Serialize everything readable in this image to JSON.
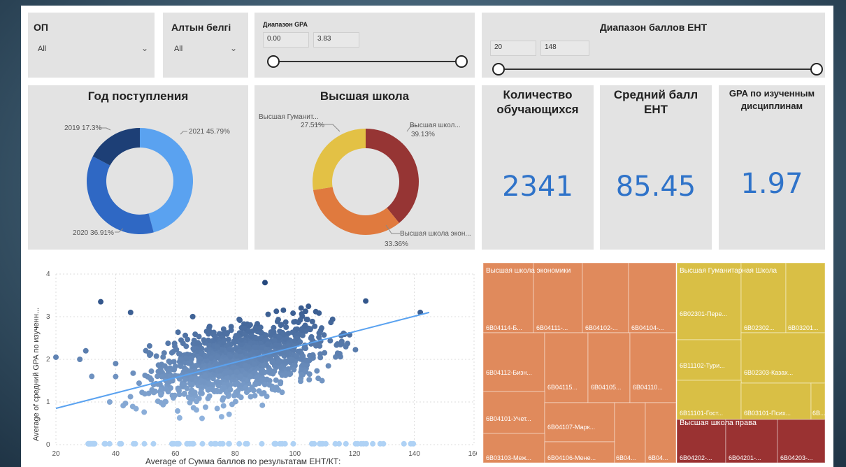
{
  "slicers": {
    "op": {
      "title": "ОП",
      "value": "All"
    },
    "gold": {
      "title": "Алтын белгі",
      "value": "All"
    },
    "gpa": {
      "title": "Диапазон GPA",
      "min": "0.00",
      "max": "3.83"
    },
    "ent": {
      "title": "Диапазон баллов ЕНТ",
      "min": "20",
      "max": "148"
    }
  },
  "kpis": {
    "count": {
      "title_line1": "Количество",
      "title_line2": "обучающихся",
      "value": "2341"
    },
    "ent_avg": {
      "title_line1": "Средний балл",
      "title_line2": "ЕНТ",
      "value": "85.45"
    },
    "gpa_avg": {
      "title_line1": "GPA по изученным",
      "title_line2": "дисциплинам",
      "value": "1.97"
    }
  },
  "colors": {
    "accent": "#2f73c9",
    "donut1": [
      "#5aa2f0",
      "#2f68c4",
      "#1d3f76"
    ],
    "donut2": [
      "#963534",
      "#e07a3e",
      "#e3c145"
    ],
    "treemap_economics": "#e08a5c",
    "treemap_humanities": "#d9bf45",
    "treemap_law": "#9a3232"
  },
  "chart_data": [
    {
      "type": "pie",
      "title": "Год поступления",
      "labels": [
        "2021",
        "2020",
        "2019"
      ],
      "values": [
        45.79,
        36.91,
        17.3
      ],
      "data_labels": [
        "2021 45.79%",
        "2020 36.91%",
        "2019 17.3%"
      ]
    },
    {
      "type": "pie",
      "title": "Высшая школа",
      "labels": [
        "Высшая школ...",
        "Высшая школа экон...",
        "Высшая Гуманит..."
      ],
      "values": [
        39.13,
        33.36,
        27.51
      ],
      "pct_labels": [
        "39.13%",
        "33.36%",
        "27.51%"
      ]
    },
    {
      "type": "scatter",
      "xlabel": "Average of Сумма баллов по результатам ЕНТ/КТ:",
      "ylabel": "Average of средний GPA по изученн...",
      "xlim": [
        20,
        160
      ],
      "ylim": [
        0,
        4
      ],
      "xticks": [
        "20",
        "40",
        "60",
        "80",
        "100",
        "120",
        "140",
        "160"
      ],
      "yticks": [
        "0",
        "1",
        "2",
        "3",
        "4"
      ],
      "trend": {
        "x": [
          20,
          145
        ],
        "y": [
          0.85,
          3.1
        ]
      },
      "sample_points": [
        [
          20,
          2.05
        ],
        [
          28,
          2.0
        ],
        [
          30,
          2.2
        ],
        [
          35,
          3.35
        ],
        [
          45,
          3.1
        ],
        [
          32,
          1.6
        ],
        [
          38,
          1.0
        ],
        [
          40,
          1.9
        ],
        [
          142,
          3.1
        ],
        [
          90,
          3.8
        ]
      ]
    },
    {
      "type": "treemap",
      "groups": [
        {
          "name": "Высшая школа экономики",
          "leaves": [
            "6B04114-Б...",
            "6B04111-...",
            "6B04102-...",
            "6B04104-...",
            "6B04112-Бизн...",
            "6B04115...",
            "6B04105...",
            "6B04110...",
            "6B04101-Учет...",
            "6B04107-Марк...",
            "6B03103-Меж...",
            "6B04106-Мене...",
            "6B04...",
            "6B04..."
          ]
        },
        {
          "name": "Высшая Гуманитарная Школа",
          "leaves": [
            "6B02301-Пере...",
            "6B02302...",
            "6B03201...",
            "6B11102-Тури...",
            "6B02303-Казах...",
            "6B11101-Гост...",
            "6B03101-Псих...",
            "6B..."
          ]
        },
        {
          "name": "Высшая школа права",
          "leaves": [
            "6B04202-...",
            "6B04201-...",
            "6B04203-..."
          ]
        }
      ]
    }
  ]
}
